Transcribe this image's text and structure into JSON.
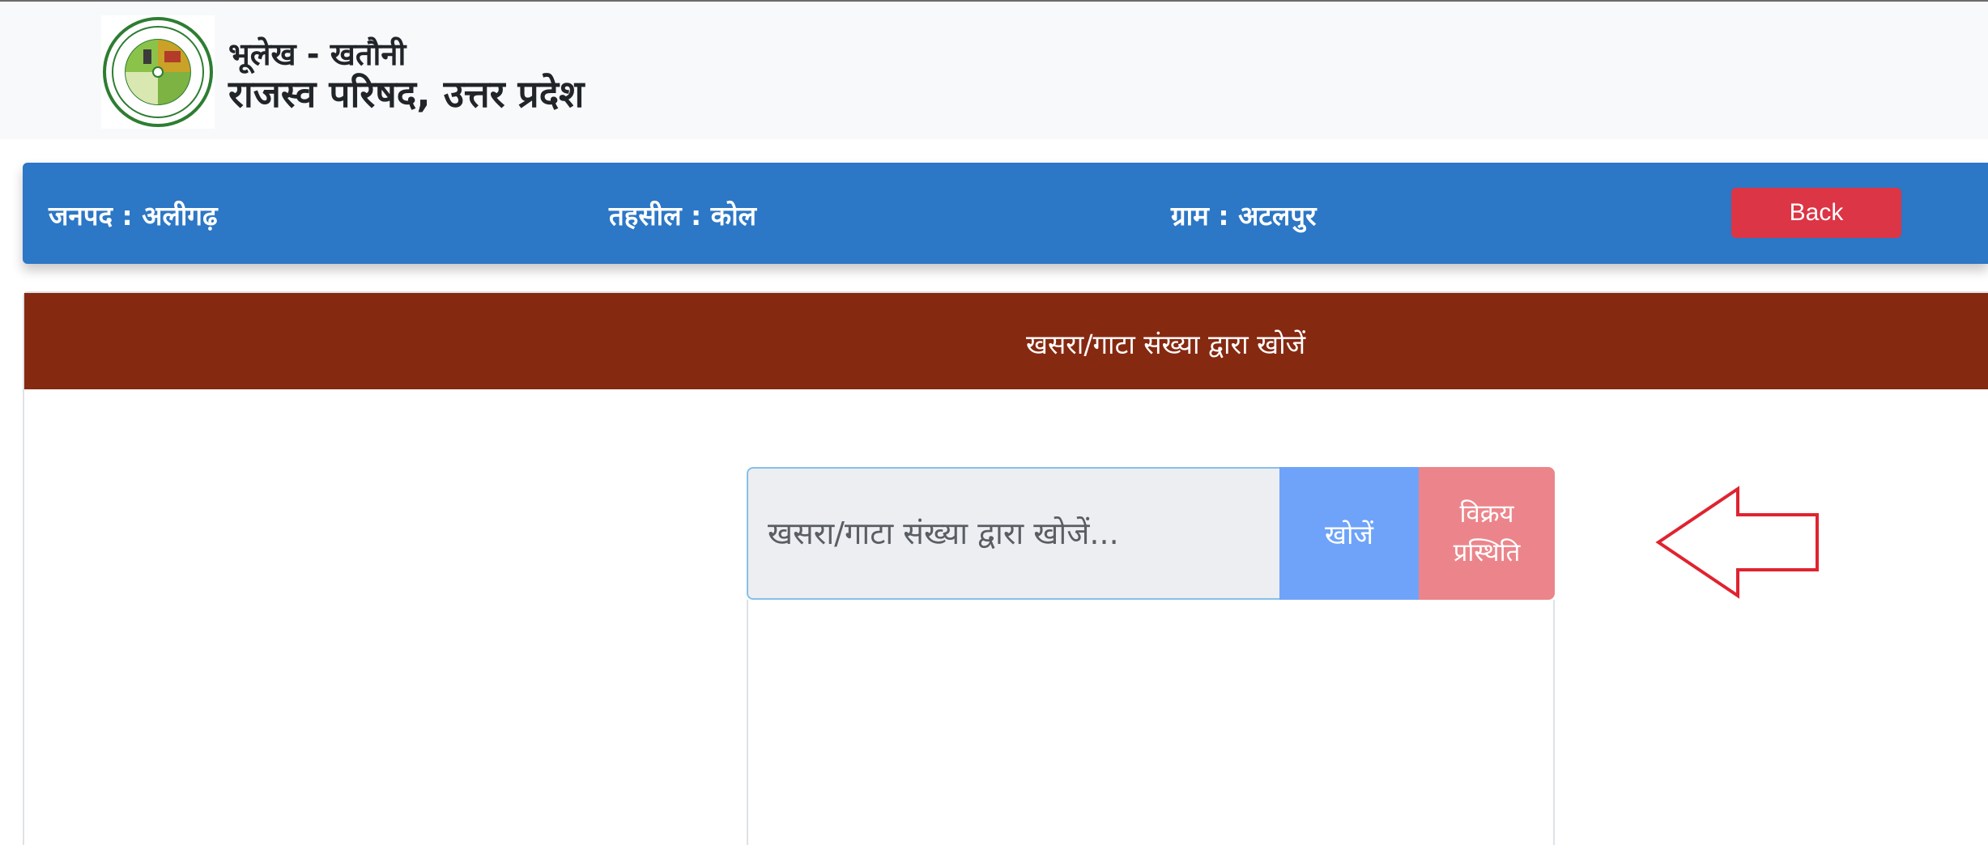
{
  "header": {
    "title_small": "भूलेख - खतौनी",
    "title_large": "राजस्व परिषद, उत्तर प्रदेश",
    "logo_icon": "rajasva-parishad-seal-icon"
  },
  "location": {
    "district": "जनपद : अलीगढ़",
    "tehsil": "तहसील : कोल",
    "village": "ग्राम : अटलपुर",
    "back_label": "Back"
  },
  "search_card": {
    "heading": "खसरा/गाटा संख्या द्वारा खोजें",
    "input_placeholder": "खसरा/गाटा संख्या द्वारा खोजें...",
    "search_label": "खोजें",
    "status_label_line1": "विक्रय",
    "status_label_line2": "प्रस्थिति"
  },
  "annotation": {
    "arrow_icon": "left-arrow-outline-icon",
    "arrow_color": "#e0232f"
  },
  "colors": {
    "location_bar": "#2c77c6",
    "card_header": "#862911",
    "back_button": "#dc3545",
    "search_button": "#6ea3f9",
    "status_button": "#ec858b"
  }
}
